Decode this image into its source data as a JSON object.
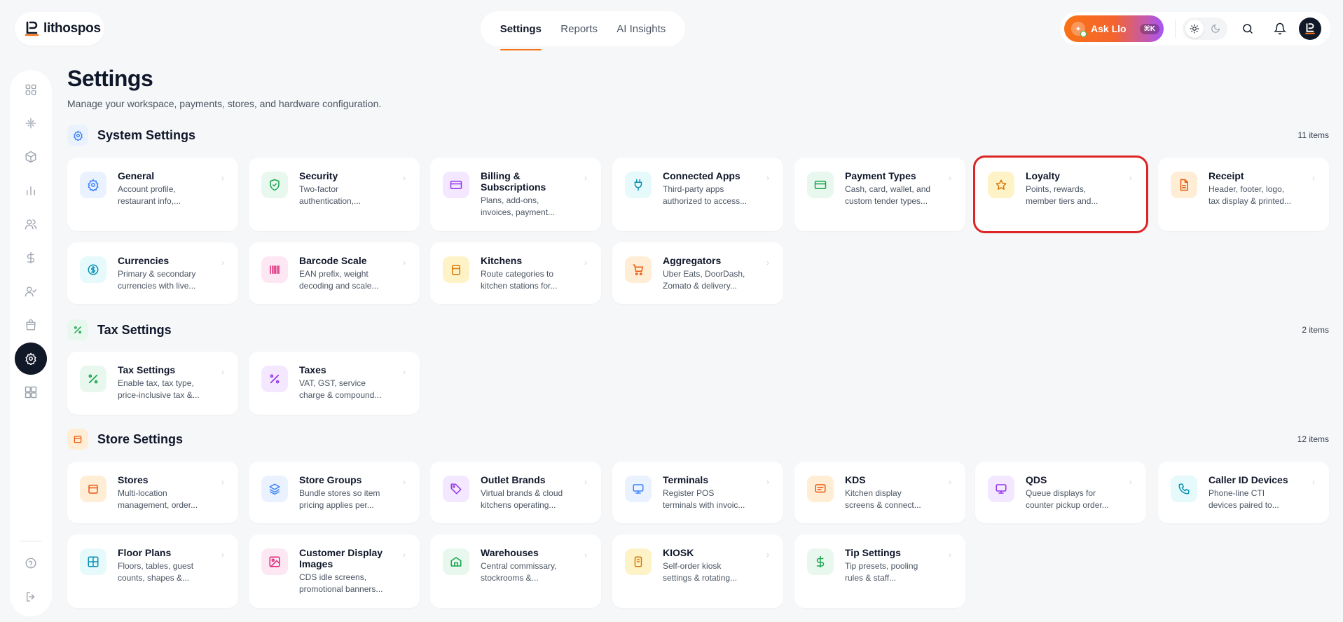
{
  "brand": {
    "name": "lithospos"
  },
  "topnav": {
    "tabs": [
      {
        "label": "Settings",
        "active": true
      },
      {
        "label": "Reports",
        "active": false
      },
      {
        "label": "AI Insights",
        "active": false
      }
    ]
  },
  "toolbar": {
    "ask_label": "Ask Llo",
    "ask_shortcut": "⌘K",
    "theme": "light",
    "icons": [
      "sun-icon",
      "moon-icon",
      "search-icon",
      "bell-icon",
      "avatar"
    ]
  },
  "sidebar": {
    "items": [
      {
        "icon": "dashboard-grid-icon"
      },
      {
        "icon": "sparkle-icon"
      },
      {
        "icon": "box-icon"
      },
      {
        "icon": "bar-chart-icon"
      },
      {
        "icon": "users-icon"
      },
      {
        "icon": "dollar-icon"
      },
      {
        "icon": "user-check-icon"
      },
      {
        "icon": "bag-icon"
      },
      {
        "icon": "gear-icon",
        "active": true
      },
      {
        "icon": "apps-icon"
      },
      {
        "icon": "help-icon"
      },
      {
        "icon": "logout-icon"
      }
    ]
  },
  "page": {
    "title": "Settings",
    "subtitle": "Manage your workspace, payments, stores, and hardware configuration."
  },
  "sections": {
    "system": {
      "title": "System Settings",
      "count": "11 items",
      "items": [
        {
          "title": "General",
          "desc1": "Account profile,",
          "desc2": "restaurant info,..."
        },
        {
          "title": "Security",
          "desc1": "Two-factor",
          "desc2": "authentication,..."
        },
        {
          "title": "Billing &",
          "title2": "Subscriptions",
          "desc1": "Plans, add-ons,",
          "desc2": "invoices, payment..."
        },
        {
          "title": "Connected Apps",
          "desc1": "Third-party apps",
          "desc2": "authorized to access..."
        },
        {
          "title": "Payment Types",
          "desc1": "Cash, card, wallet, and",
          "desc2": "custom tender types..."
        },
        {
          "title": "Loyalty",
          "desc1": "Points, rewards,",
          "desc2": "member tiers and..."
        },
        {
          "title": "Receipt",
          "desc1": "Header, footer, logo,",
          "desc2": "tax display & printed..."
        },
        {
          "title": "Currencies",
          "desc1": "Primary & secondary",
          "desc2": "currencies with live..."
        },
        {
          "title": "Barcode Scale",
          "desc1": "EAN prefix, weight",
          "desc2": "decoding and scale..."
        },
        {
          "title": "Kitchens",
          "desc1": "Route categories to",
          "desc2": "kitchen stations for..."
        },
        {
          "title": "Aggregators",
          "desc1": "Uber Eats, DoorDash,",
          "desc2": "Zomato & delivery..."
        }
      ]
    },
    "tax": {
      "title": "Tax Settings",
      "count": "2 items",
      "items": [
        {
          "title": "Tax Settings",
          "desc1": "Enable tax, tax type,",
          "desc2": "price-inclusive tax &..."
        },
        {
          "title": "Taxes",
          "desc1": "VAT, GST, service",
          "desc2": "charge & compound..."
        }
      ]
    },
    "store": {
      "title": "Store Settings",
      "count": "12 items",
      "items": [
        {
          "title": "Stores",
          "desc1": "Multi-location",
          "desc2": "management, order..."
        },
        {
          "title": "Store Groups",
          "desc1": "Bundle stores so item",
          "desc2": "pricing applies per..."
        },
        {
          "title": "Outlet Brands",
          "desc1": "Virtual brands & cloud",
          "desc2": "kitchens operating..."
        },
        {
          "title": "Terminals",
          "desc1": "Register POS",
          "desc2": "terminals with invoic..."
        },
        {
          "title": "KDS",
          "desc1": "Kitchen display",
          "desc2": "screens & connect..."
        },
        {
          "title": "QDS",
          "desc1": "Queue displays for",
          "desc2": "counter pickup order..."
        },
        {
          "title": "Caller ID Devices",
          "desc1": "Phone-line CTI",
          "desc2": "devices paired to..."
        },
        {
          "title": "Floor Plans",
          "desc1": "Floors, tables, guest",
          "desc2": "counts, shapes &..."
        },
        {
          "title": "Customer Display",
          "title2": "Images",
          "desc1": "CDS idle screens,",
          "desc2": "promotional banners..."
        },
        {
          "title": "Warehouses",
          "desc1": "Central commissary,",
          "desc2": "stockrooms &..."
        },
        {
          "title": "KIOSK",
          "desc1": "Self-order kiosk",
          "desc2": "settings & rotating..."
        },
        {
          "title": "Tip Settings",
          "desc1": "Tip presets, pooling",
          "desc2": "rules & staff..."
        }
      ]
    }
  },
  "colors": {
    "accent": "#f97316",
    "highlight": "#dc2626",
    "sidebar_active": "#111827"
  }
}
